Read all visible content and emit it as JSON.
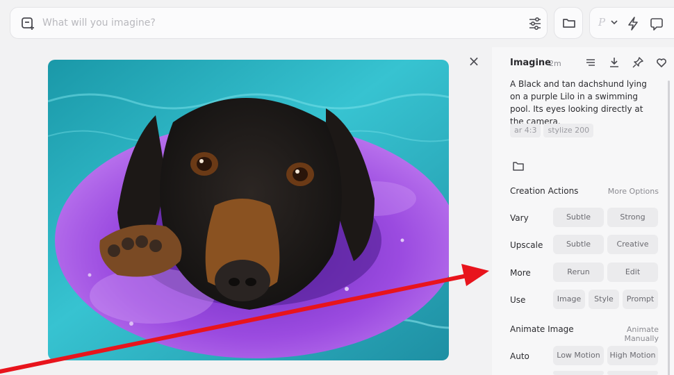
{
  "search": {
    "placeholder": "What will you imagine?"
  },
  "toolbar": {
    "personalize_glyph": "P"
  },
  "image": {
    "alt": ""
  },
  "panel": {
    "title": "Imagine",
    "time": "2m",
    "prompt": "A Black and tan dachshund lying on a purple Lilo in a swimming pool. Its eyes looking directly at the camera.",
    "params": [
      "ar 4:3",
      "stylize 200"
    ],
    "creation": {
      "title": "Creation Actions",
      "link": "More Options",
      "rows": [
        {
          "label": "Vary",
          "buttons": [
            "Subtle",
            "Strong"
          ]
        },
        {
          "label": "Upscale",
          "buttons": [
            "Subtle",
            "Creative"
          ]
        },
        {
          "label": "More",
          "buttons": [
            "Rerun",
            "Edit"
          ]
        },
        {
          "label": "Use",
          "buttons": [
            "Image",
            "Style",
            "Prompt"
          ]
        }
      ]
    },
    "animate": {
      "title": "Animate Image",
      "link": "Animate Manually",
      "rows": [
        {
          "label": "Auto",
          "buttons": [
            "Low Motion",
            "High Motion"
          ]
        }
      ]
    }
  },
  "colors": {
    "annotation_arrow": "#e8141c",
    "pool_water": "#2bb3c4",
    "lilo": "#8b3fd6"
  },
  "icons": [
    "new-prompt-icon",
    "settings-sliders-icon",
    "folder-icon",
    "chevron-down-icon",
    "bolt-icon",
    "chat-icon",
    "close-icon",
    "menu-icon",
    "download-icon",
    "pin-icon",
    "heart-icon"
  ]
}
